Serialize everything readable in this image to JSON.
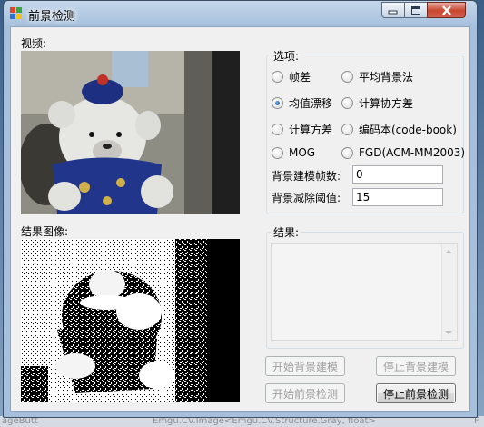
{
  "window": {
    "title": "前景检测"
  },
  "video_label": "视频:",
  "result_image_label": "结果图像:",
  "options": {
    "legend": "选项:",
    "radios": [
      {
        "label": "帧差",
        "checked": false
      },
      {
        "label": "平均背景法",
        "checked": false
      },
      {
        "label": "均值漂移",
        "checked": true
      },
      {
        "label": "计算协方差",
        "checked": false
      },
      {
        "label": "计算方差",
        "checked": false
      },
      {
        "label": "编码本(code-book)",
        "checked": false
      },
      {
        "label": "MOG",
        "checked": false
      },
      {
        "label": "FGD(ACM-MM2003)",
        "checked": false
      }
    ],
    "frames_label": "背景建模帧数:",
    "frames_value": "0",
    "threshold_label": "背景减除阈值:",
    "threshold_value": "15"
  },
  "result": {
    "legend": "结果:",
    "text": ""
  },
  "buttons": {
    "start_bg": "开始背景建模",
    "stop_bg": "停止背景建模",
    "start_fg": "开始前景检测",
    "stop_fg": "停止前景检测"
  },
  "background_status": {
    "left": "ageButt",
    "middle": "Emgu.CV.Image<Emgu.CV.Structure.Gray, float>",
    "right": "F"
  }
}
